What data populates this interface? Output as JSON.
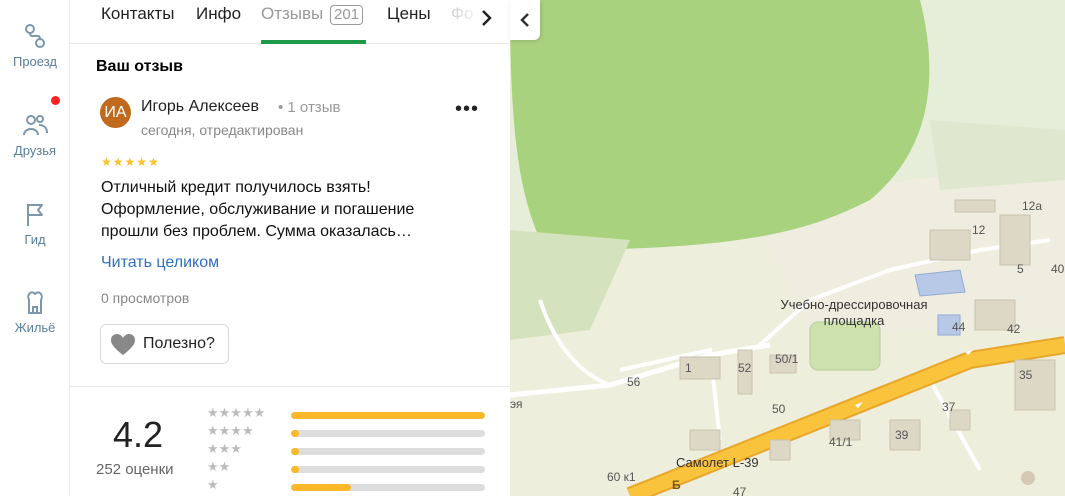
{
  "rail": {
    "items": [
      {
        "label": "Проезд",
        "icon": "route-icon"
      },
      {
        "label": "Друзья",
        "icon": "friends-icon"
      },
      {
        "label": "Гид",
        "icon": "flag-icon"
      },
      {
        "label": "Жильё",
        "icon": "house-icon"
      }
    ]
  },
  "tabs": {
    "items": [
      "Контакты",
      "Инфо",
      "Отзывы",
      "Цены",
      "Фо"
    ],
    "reviews_count": "201"
  },
  "review": {
    "section_title": "Ваш отзыв",
    "avatar_initials": "ИА",
    "author": "Игорь Алексеев",
    "author_meta": "• 1 отзыв",
    "date": "сегодня, отредактирован",
    "stars": "★★★★★",
    "rating_value": 5,
    "text": "Отличный кредит получилось взять! Оформление, обслуживание и погашение прошли без проблем. Сумма оказалась…",
    "read_more": "Читать целиком",
    "views": "0 просмотров",
    "useful_label": "Полезно?"
  },
  "rating": {
    "value": "4.2",
    "count_label": "252 оценки",
    "distribution": [
      {
        "stars": "★★★★★",
        "fraction": 1.0
      },
      {
        "stars": "★★★★",
        "fraction": 0.04
      },
      {
        "stars": "★★★",
        "fraction": 0.04
      },
      {
        "stars": "★★",
        "fraction": 0.04
      },
      {
        "stars": "★",
        "fraction": 0.31
      }
    ]
  },
  "map": {
    "collapse": "‹",
    "labels": [
      "12а",
      "12",
      "5",
      "40",
      "44",
      "42",
      "50/1",
      "52",
      "1",
      "56",
      "50",
      "35",
      "37",
      "39",
      "41/1",
      "60 к1",
      "47",
      "Б",
      "эя"
    ],
    "places": [
      "Учебно-дрессировочная площадка",
      "Самолет L-39"
    ]
  },
  "colors": {
    "accent_green": "#1e9b4a",
    "link_blue": "#2f6fc6",
    "star_yellow": "#fbc02d",
    "avatar": "#c06a1d",
    "notification_red": "#ff2222"
  }
}
